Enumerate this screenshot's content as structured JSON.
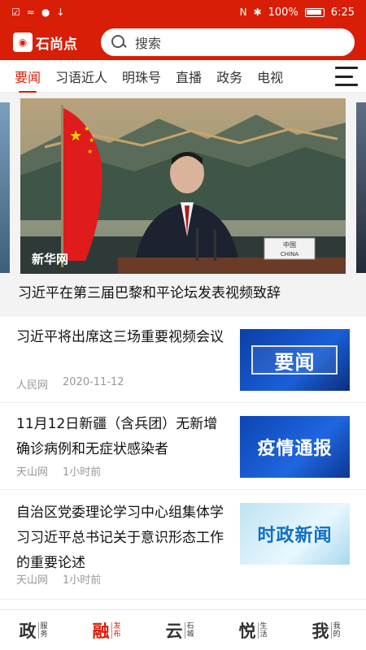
{
  "status_bar": {
    "left_icons": [
      "notification-icon",
      "wifi-icon",
      "app-icon",
      "download-icon"
    ],
    "right_icons": [
      "nfc-icon",
      "bluetooth-icon"
    ],
    "battery_text": "100%",
    "time": "6:25"
  },
  "header": {
    "logo_text": "石尚点",
    "search_placeholder": "搜索"
  },
  "tabs": [
    "要闻",
    "习语近人",
    "明珠号",
    "直播",
    "政务",
    "电视"
  ],
  "active_tab": 0,
  "hero": {
    "caption": "习近平在第三届巴黎和平论坛发表视频致辞",
    "watermark": "新华网",
    "nameplate_cn": "中国",
    "nameplate_en": "CHINA"
  },
  "news": [
    {
      "title": "习近平将出席这三场重要视频会议",
      "source": "人民网",
      "time": "2020-11-12",
      "thumb_text": "要闻"
    },
    {
      "title": "11月12日新疆（含兵团）无新增确诊病例和无症状感染者",
      "source": "天山网",
      "time": "1小时前",
      "thumb_text": "疫情通报"
    },
    {
      "title": "自治区党委理论学习中心组集体学习习近平总书记关于意识形态工作的重要论述",
      "source": "天山网",
      "time": "1小时前",
      "thumb_text": "时政新闻"
    }
  ],
  "bottom_nav": [
    {
      "big": "政",
      "small": "服务"
    },
    {
      "big": "融",
      "small": "发布"
    },
    {
      "big": "云",
      "small": "石城"
    },
    {
      "big": "悦",
      "small": "生活"
    },
    {
      "big": "我",
      "small": "我的"
    }
  ],
  "colors": {
    "brand_red": "#d81e06",
    "text_primary": "#111111",
    "text_meta": "#999999"
  }
}
